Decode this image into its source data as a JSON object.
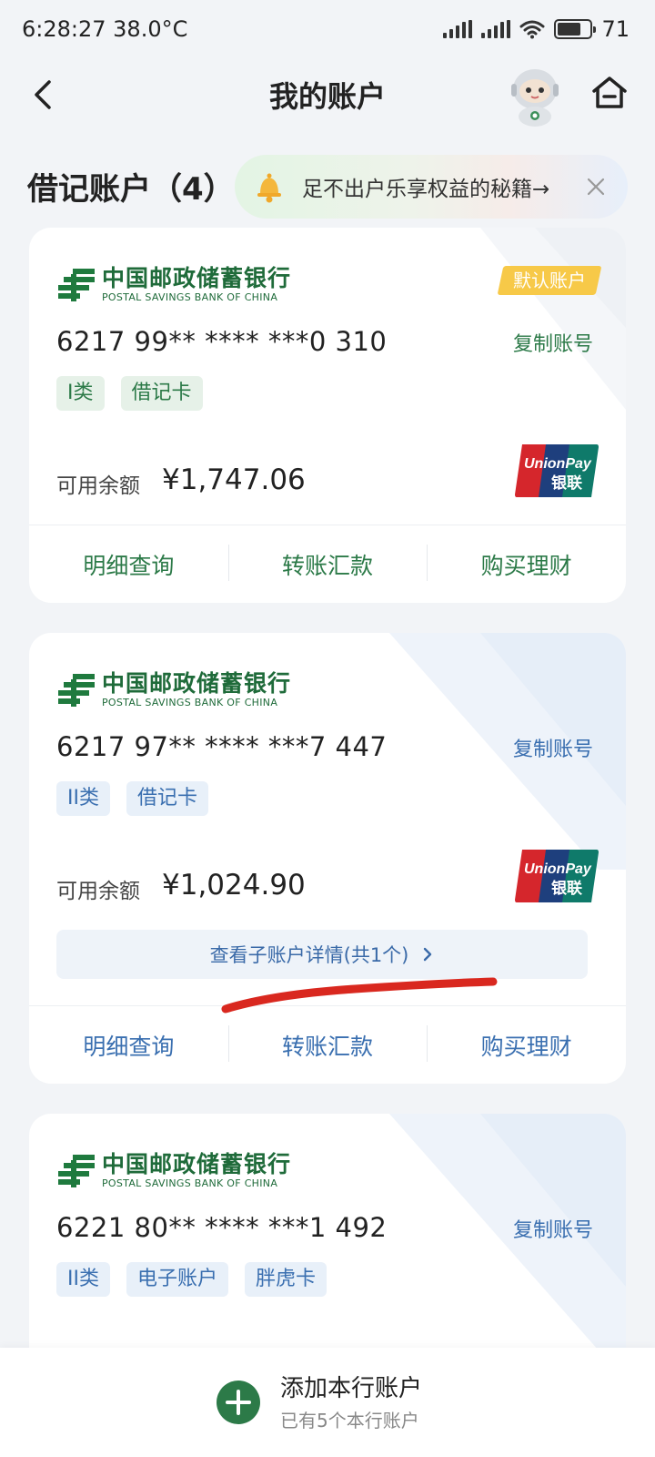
{
  "status_bar": {
    "time_temp": "6:28:27 38.0°C",
    "battery": "71",
    "battery_fraction": 0.71
  },
  "header": {
    "title": "我的账户",
    "icons": [
      "back-arrow-icon",
      "robot-mascot-icon",
      "home-icon"
    ]
  },
  "section": {
    "title": "借记账户（4）"
  },
  "promo": {
    "text": "足不出户乐享权益的秘籍→",
    "icons": [
      "bell-icon",
      "close-icon"
    ]
  },
  "bank": {
    "name_cn": "中国邮政储蓄银行",
    "name_en": "POSTAL SAVINGS BANK OF CHINA"
  },
  "cards": [
    {
      "default_badge": "默认账户",
      "account_no": "6217 99** **** ***0 310",
      "copy_label": "复制账号",
      "tags": [
        "I类",
        "借记卡"
      ],
      "balance_label": "可用余额",
      "balance": "¥1,747.06",
      "actions": [
        "明细查询",
        "转账汇款",
        "购买理财"
      ],
      "theme_color": "#2c7a48"
    },
    {
      "account_no": "6217 97** **** ***7 447",
      "copy_label": "复制账号",
      "tags": [
        "II类",
        "借记卡"
      ],
      "balance_label": "可用余额",
      "balance": "¥1,024.90",
      "sub_accounts": "查看子账户详情(共1个)",
      "actions": [
        "明细查询",
        "转账汇款",
        "购买理财"
      ],
      "theme_color": "#3a6fb0"
    },
    {
      "account_no": "6221 80** **** ***1 492",
      "copy_label": "复制账号",
      "tags": [
        "II类",
        "电子账户",
        "胖虎卡"
      ],
      "theme_color": "#3a6fb0"
    }
  ],
  "unionpay": {
    "text_en": "UnionPay",
    "text_cn": "银联"
  },
  "bottom": {
    "add_title": "添加本行账户",
    "add_sub": "已有5个本行账户",
    "icon": "plus-circle-icon",
    "accent": "#2c7a48"
  }
}
